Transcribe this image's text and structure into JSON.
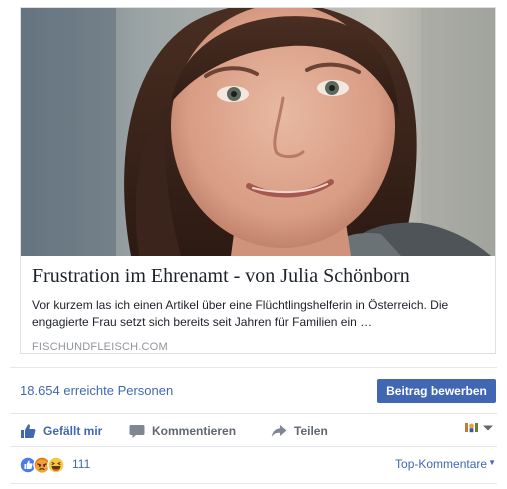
{
  "link_preview": {
    "image": "portrait-photo",
    "title": "Frustration im Ehrenamt - von Julia Schönborn",
    "description": "Vor kurzem las ich einen Artikel über eine Flüchtlingshelferin in Österreich. Die engagierte Frau setzt sich bereits seit Jahren für Familien ein …",
    "domain": "FISCHUNDFLEISCH.COM"
  },
  "insights": {
    "reach": "18.654 erreichte Personen",
    "boost_label": "Beitrag bewerben"
  },
  "actions": {
    "like": {
      "label": "Gefällt mir",
      "icon": "thumbs-up-icon"
    },
    "comment": {
      "label": "Kommentieren",
      "icon": "comment-icon"
    },
    "share": {
      "label": "Teilen",
      "icon": "share-arrow-icon"
    },
    "viewer_icon": "post-as-selector-icon"
  },
  "reactions": {
    "icons": [
      "like-reaction-icon",
      "angry-reaction-icon",
      "haha-reaction-icon"
    ],
    "count": "111",
    "sort_label": "Top-Kommentare"
  },
  "colors": {
    "link_blue": "#4267b2",
    "text": "#1d2129",
    "muted": "#90949c",
    "border": "#dddfe2"
  }
}
